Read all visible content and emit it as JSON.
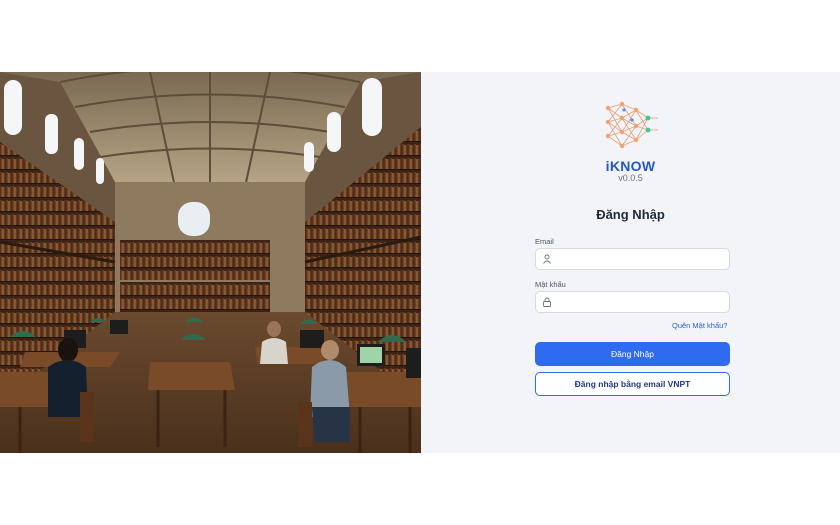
{
  "app": {
    "name": "iKNOW",
    "version": "v0.0.5"
  },
  "login": {
    "heading": "Đăng Nhập",
    "email_label": "Email",
    "email_value": "",
    "password_label": "Mật khẩu",
    "password_value": "",
    "forgot_label": "Quên Mật khẩu?",
    "submit_label": "Đăng Nhập",
    "vnpt_label": "Đăng nhập bằng email VNPT"
  },
  "icons": {
    "email_field": "user-icon",
    "password_field": "lock-icon",
    "logo": "neural-network-logo"
  },
  "colors": {
    "primary": "#2f6bf0",
    "brand_text": "#2257c9",
    "panel_bg": "#f3f4f8"
  }
}
